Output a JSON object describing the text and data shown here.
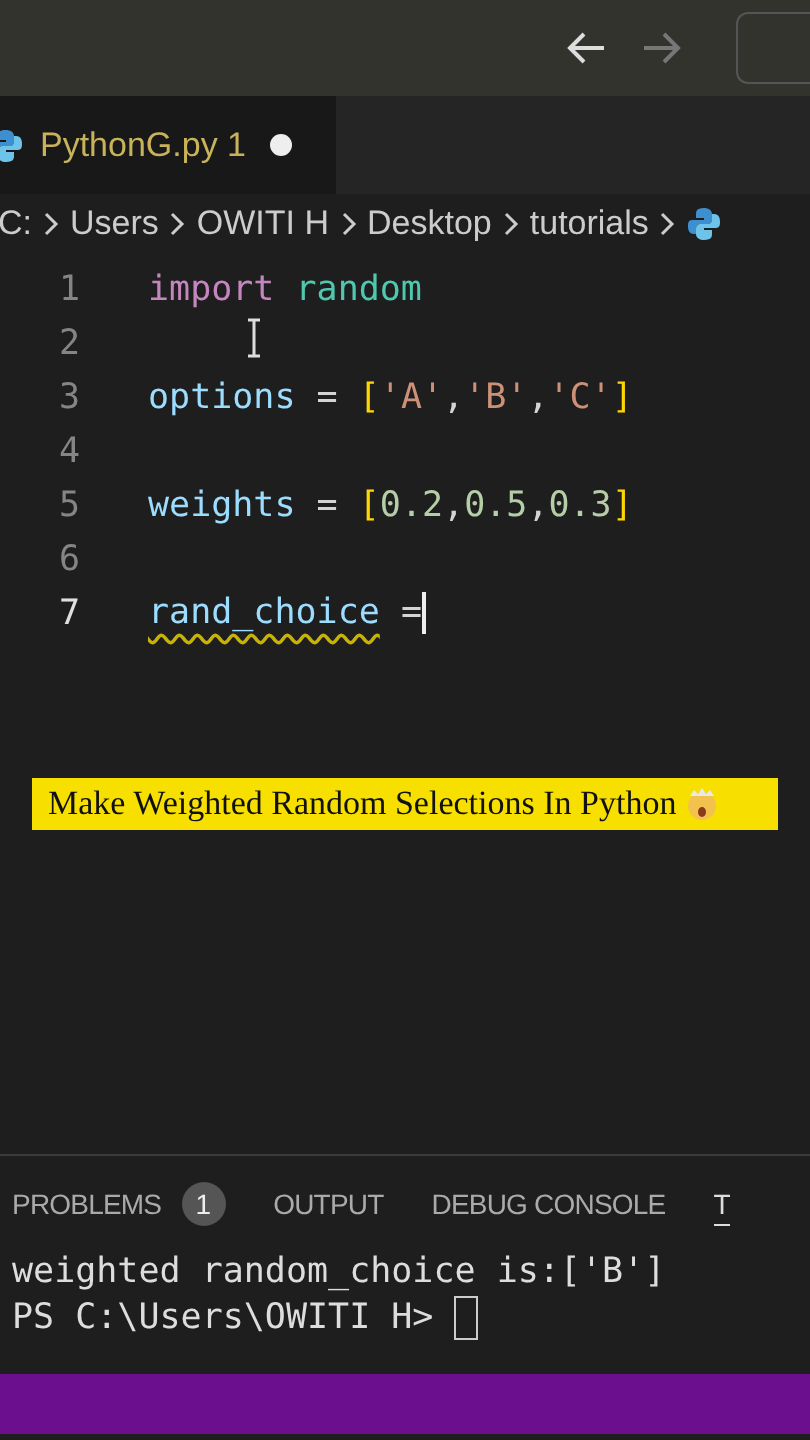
{
  "title_bar": {
    "back_disabled": false,
    "forward_disabled": true
  },
  "tabs": [
    {
      "label": "PythonG.py 1",
      "selected": true,
      "modified": true
    }
  ],
  "breadcrumb": [
    "C:",
    "Users",
    "OWITI H",
    "Desktop",
    "tutorials"
  ],
  "code_lines": [
    {
      "number": "1",
      "current": false,
      "tokens": [
        {
          "text": "import",
          "kind": "keyword"
        },
        {
          "text": "random",
          "kind": "module"
        }
      ]
    },
    {
      "number": "2",
      "current": false
    },
    {
      "number": "3",
      "current": false,
      "tokens": [
        {
          "text": "options",
          "kind": "variable"
        },
        {
          "text": " = ",
          "kind": "operator"
        },
        {
          "text": "[",
          "kind": "bracket"
        },
        {
          "text": "'A'",
          "kind": "string"
        },
        {
          "text": ",",
          "kind": "punct"
        },
        {
          "text": "'B'",
          "kind": "string"
        },
        {
          "text": ",",
          "kind": "punct"
        },
        {
          "text": "'C'",
          "kind": "string"
        },
        {
          "text": "]",
          "kind": "bracket"
        }
      ]
    },
    {
      "number": "4",
      "current": false
    },
    {
      "number": "5",
      "current": false,
      "tokens": [
        {
          "text": "weights",
          "kind": "variable"
        },
        {
          "text": " = ",
          "kind": "operator"
        },
        {
          "text": "[",
          "kind": "bracket"
        },
        {
          "text": "0.2",
          "kind": "number"
        },
        {
          "text": ",",
          "kind": "punct"
        },
        {
          "text": "0.5",
          "kind": "number"
        },
        {
          "text": ",",
          "kind": "punct"
        },
        {
          "text": "0.3",
          "kind": "number"
        },
        {
          "text": "]",
          "kind": "bracket"
        }
      ]
    },
    {
      "number": "6",
      "current": false
    },
    {
      "number": "7",
      "current": true,
      "tokens": [
        {
          "text": "rand_choice",
          "kind": "warning"
        },
        {
          "text": " =",
          "kind": "operator"
        }
      ]
    }
  ],
  "caption": "Make Weighted Random Selections In Python",
  "panel_tabs": [
    {
      "label": "PROBLEMS",
      "badge": "1",
      "selected": false
    },
    {
      "label": "OUTPUT",
      "selected": false
    },
    {
      "label": "DEBUG CONSOLE",
      "selected": false
    },
    {
      "label": "T",
      "selected": true
    }
  ],
  "terminal_lines": [
    "weighted random_choice is:['B']",
    "PS C:\\Users\\OWITI H>"
  ]
}
